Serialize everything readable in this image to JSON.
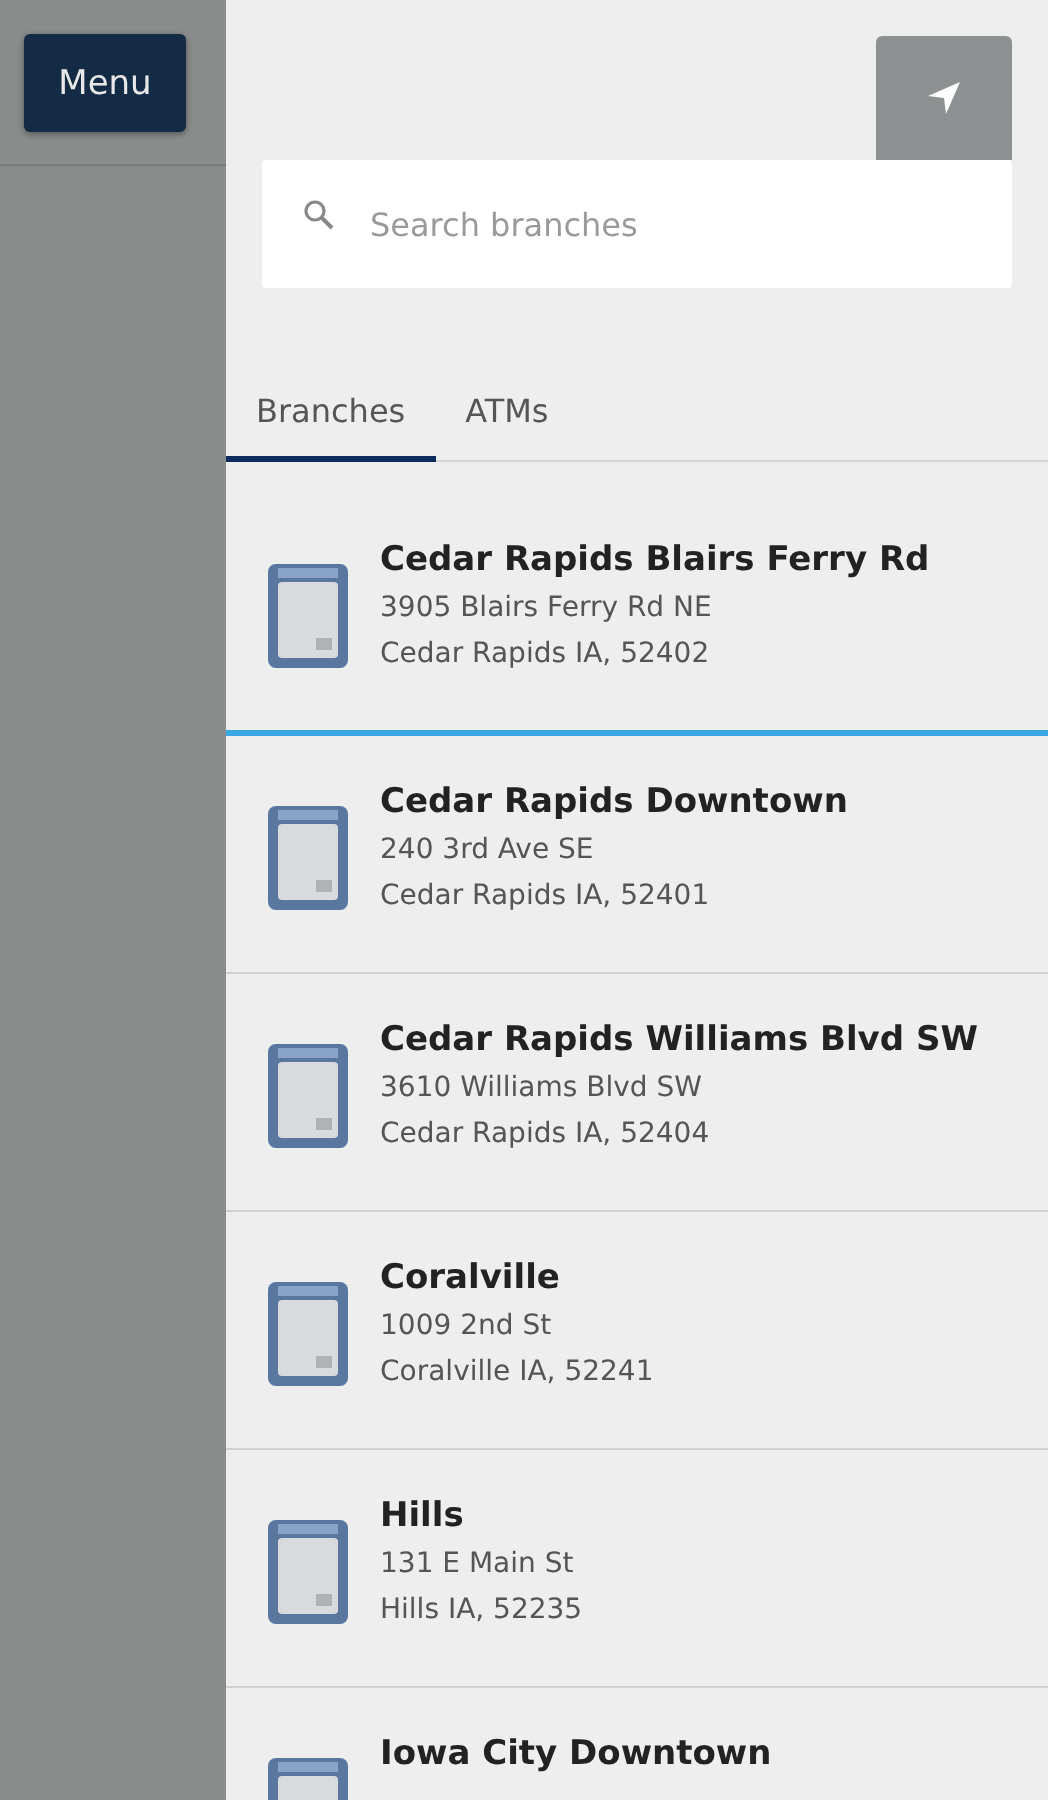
{
  "sidebar": {
    "menu_button": "Menu"
  },
  "search": {
    "placeholder": "Search branches"
  },
  "tabs": [
    {
      "label": "Branches",
      "selected": true
    },
    {
      "label": "ATMs",
      "selected": false
    }
  ],
  "branches": [
    {
      "name": "Cedar Rapids Blairs Ferry Rd",
      "address": "3905 Blairs Ferry Rd NE",
      "city": "Cedar Rapids IA, 52402",
      "selected": true
    },
    {
      "name": "Cedar Rapids Downtown",
      "address": "240 3rd Ave SE",
      "city": "Cedar Rapids IA, 52401",
      "selected": false
    },
    {
      "name": "Cedar Rapids Williams Blvd SW",
      "address": "3610 Williams Blvd SW",
      "city": "Cedar Rapids IA, 52404",
      "selected": false
    },
    {
      "name": "Coralville",
      "address": "1009 2nd St",
      "city": "Coralville IA, 52241",
      "selected": false
    },
    {
      "name": "Hills",
      "address": "131 E Main St",
      "city": "Hills IA, 52235",
      "selected": false
    },
    {
      "name": "Iowa City Downtown",
      "selected": false
    }
  ]
}
